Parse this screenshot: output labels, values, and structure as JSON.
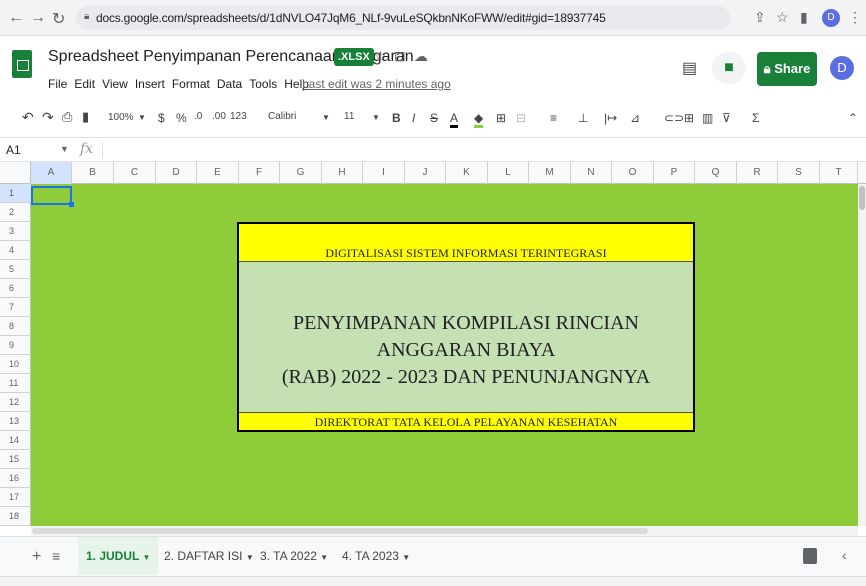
{
  "browser": {
    "url": "docs.google.com/spreadsheets/d/1dNVLO47JqM6_NLf-9vuLeSQkbnNKoFWW/edit#gid=18937745",
    "profile_initial": "D",
    "back_icon": "arrow-left-icon",
    "forward_icon": "arrow-right-icon",
    "reload_icon": "reload-icon"
  },
  "app": {
    "title": "Spreadsheet Penyimpanan Perencanaan Anggaran",
    "file_badge": ".XLSX",
    "menus": [
      "File",
      "Edit",
      "View",
      "Insert",
      "Format",
      "Data",
      "Tools",
      "Help"
    ],
    "last_edit": "Last edit was 2 minutes ago",
    "share_label": "Share",
    "avatar_initial": "D"
  },
  "toolbar": {
    "zoom": "100%",
    "currency": "$",
    "percent": "%",
    "dec_decrease": ".0",
    "dec_increase": ".00",
    "more_formats": "123",
    "font": "Calibri",
    "font_size": "11",
    "bold": "B",
    "italic": "I",
    "strike": "S",
    "text_color": "A"
  },
  "formula_bar": {
    "cell_ref": "A1",
    "fx": "fx",
    "value": ""
  },
  "grid": {
    "columns": [
      "A",
      "B",
      "C",
      "D",
      "E",
      "F",
      "G",
      "H",
      "I",
      "J",
      "K",
      "L",
      "M",
      "N",
      "O",
      "P",
      "Q",
      "R",
      "S",
      "T"
    ],
    "rows": [
      "1",
      "2",
      "3",
      "4",
      "5",
      "6",
      "7",
      "8",
      "9",
      "10",
      "11",
      "12",
      "13",
      "14",
      "15",
      "16",
      "17",
      "18"
    ],
    "background": "#8ecc3a"
  },
  "content": {
    "header_text": "DIGITALISASI SISTEM INFORMASI TERINTEGRASI",
    "main_line1": "PENYIMPANAN KOMPILASI RINCIAN ANGGARAN BIAYA",
    "main_line2": "(RAB) 2022 - 2023 DAN PENUNJANGNYA",
    "footer_text": "DIREKTORAT TATA KELOLA PELAYANAN KESEHATAN"
  },
  "sheets": {
    "tabs": [
      "1. JUDUL",
      "2. DAFTAR ISI",
      "3. TA 2022",
      "4. TA 2023"
    ],
    "active_index": 0
  }
}
